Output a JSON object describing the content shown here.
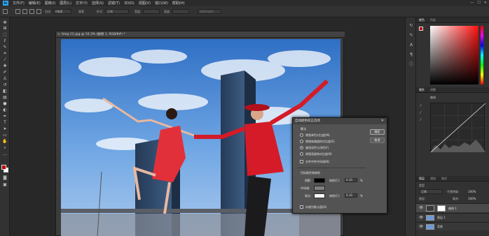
{
  "menubar": {
    "app_logo": "Ps",
    "items": [
      "文件(F)",
      "编辑(E)",
      "图像(I)",
      "图层(L)",
      "文字(Y)",
      "选择(S)",
      "滤镜(T)",
      "3D(D)",
      "视图(V)",
      "窗口(W)",
      "帮助(H)"
    ],
    "window_controls": [
      "—",
      "☐",
      "✕"
    ]
  },
  "optionsbar": {
    "field1": "像素",
    "label_feather": "羽化:",
    "field2": "0像素",
    "label_style": "样式:",
    "field3": "正常",
    "label_width": "宽度:",
    "label_height": "高度:",
    "select_mask": "选择并遮住..."
  },
  "tools": {
    "icons": [
      "move-tool",
      "artboard-tool",
      "marquee-tool",
      "lasso-tool",
      "quick-select-tool",
      "crop-tool",
      "eyedropper-tool",
      "healing-tool",
      "brush-tool",
      "clone-stamp-tool",
      "history-brush-tool",
      "eraser-tool",
      "gradient-tool",
      "blur-tool",
      "dodge-tool",
      "pen-tool",
      "type-tool",
      "path-select-tool",
      "shape-tool",
      "hand-tool",
      "zoom-tool",
      "more-tools"
    ],
    "foreground_color": "#c00000",
    "background_color": "#ffffff"
  },
  "document": {
    "tab_title": "timg (1).jpg @ 33.3% (曲线 1, RGB/8#) *",
    "close_glyph": "×"
  },
  "dialog": {
    "title": "自动颜色校正选项",
    "close_glyph": "✕",
    "section_algorithm": "算法",
    "options": [
      "增强单色对比度(M)",
      "增强每通道的对比度(E)",
      "查找深色与浅色(F)",
      "增强亮度和对比度(B)"
    ],
    "selected_option_index": 2,
    "snap_neutral_midtones": "对齐中性中间调(N)",
    "snap_checked": false,
    "section_target": "目标颜色和修剪",
    "shadows_label": "阴影:",
    "midtones_label": "中间调:",
    "highlights_label": "高光:",
    "clip_label": "修剪(C):",
    "clip_shadows_value": "0.10",
    "clip_highlights_value": "0.10",
    "percent": "%",
    "shadow_color": "#000000",
    "midtone_color": "#808080",
    "highlight_color": "#ffffff",
    "save_defaults": "存储为默认值(D)",
    "ok_label": "确定",
    "cancel_label": "取消"
  },
  "right_panels": {
    "color_tabs": [
      "颜色",
      "色板"
    ],
    "properties_tabs": [
      "属性",
      "调整"
    ],
    "properties_preset": "曲线",
    "layers_tabs": [
      "图层",
      "通道",
      "路径"
    ],
    "layer_filter_label": "类型",
    "blend_mode": "正常",
    "opacity_label": "不透明度:",
    "opacity_value": "100%",
    "lock_label": "锁定:",
    "fill_label": "填充:",
    "fill_value": "100%",
    "layers": [
      {
        "name": "曲线 1"
      },
      {
        "name": "图层 1"
      },
      {
        "name": "背景"
      }
    ]
  },
  "right_column": {
    "icons": [
      "history-icon",
      "brush-settings-icon",
      "character-icon",
      "paragraph-icon",
      "info-icon"
    ]
  }
}
